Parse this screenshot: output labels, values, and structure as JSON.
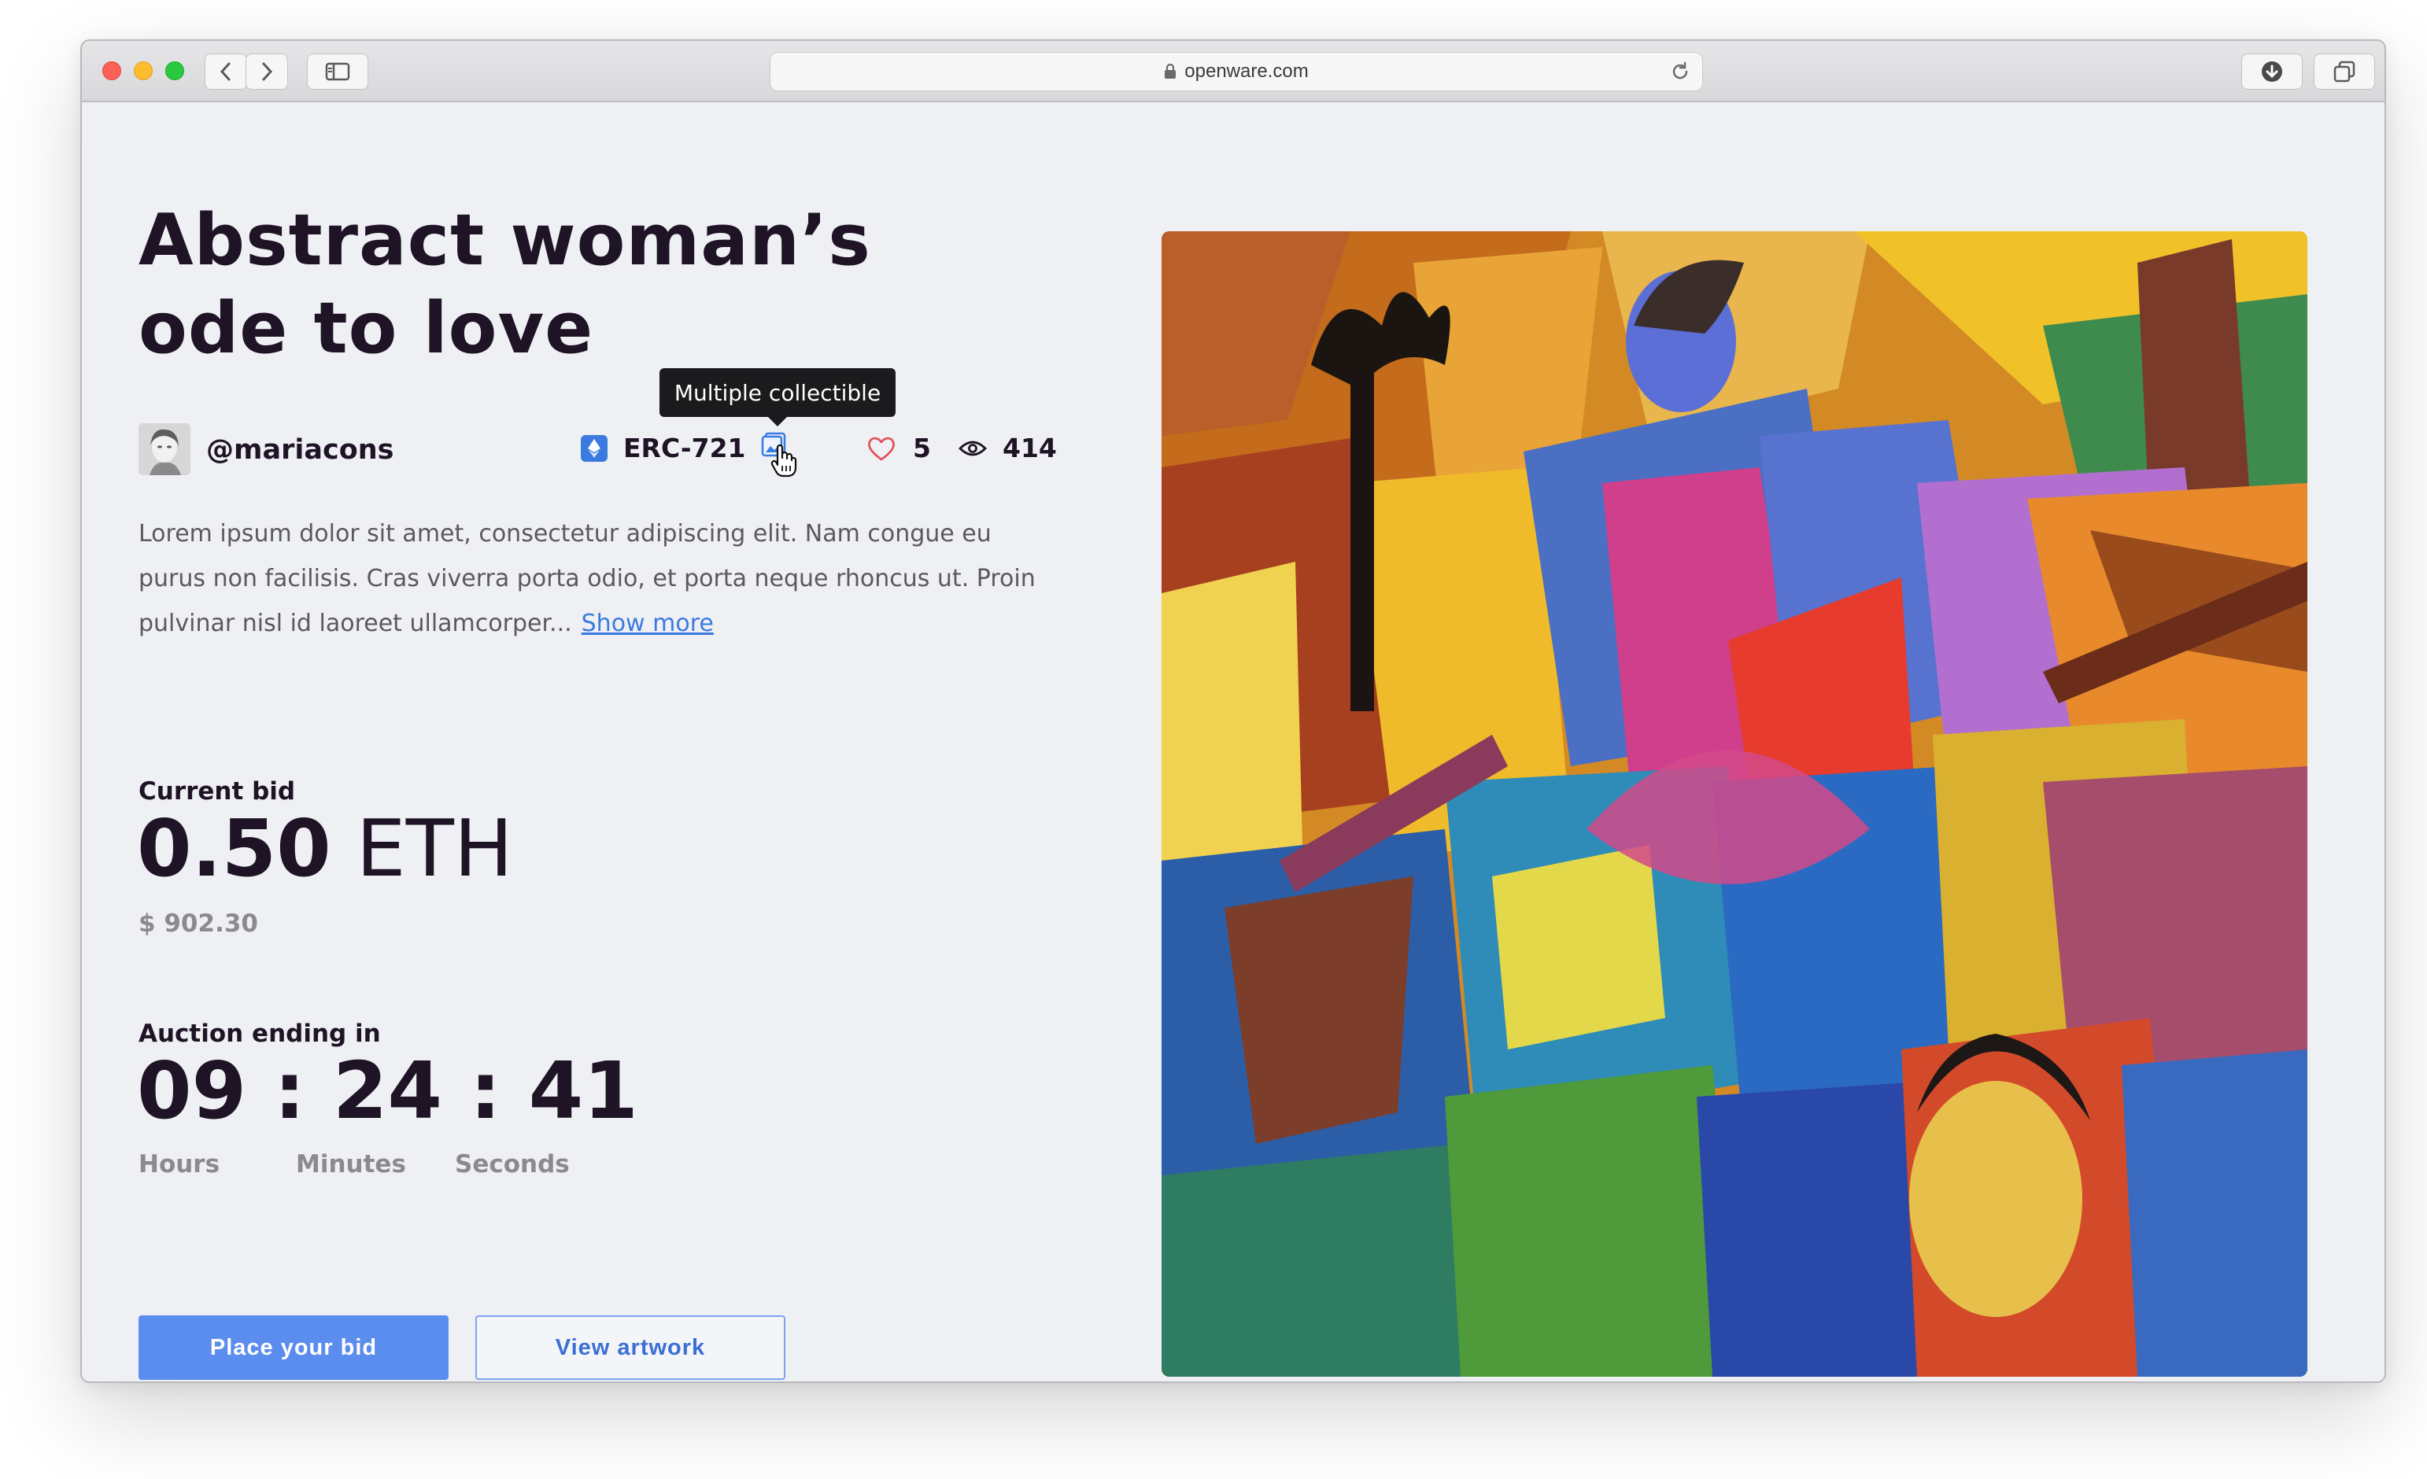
{
  "browser": {
    "url": "openware.com"
  },
  "nft": {
    "title_line1": "Abstract woman’s",
    "title_line2": "ode to love",
    "creator": "@mariacons",
    "standard": "ERC-721",
    "likes": "5",
    "views": "414",
    "tooltip": "Multiple collectible",
    "description": "Lorem ipsum dolor sit amet, consectetur adipiscing elit. Nam congue eu purus non facilisis. Cras viverra porta odio, et porta neque rhoncus ut. Proin pulvinar nisl id laoreet ullamcorper...",
    "show_more": "Show more"
  },
  "bid": {
    "label": "Current bid",
    "amount": "0.50",
    "currency": "ETH",
    "usd": "$ 902.30"
  },
  "auction": {
    "label": "Auction ending in",
    "hours": "09",
    "minutes": "24",
    "seconds": "41",
    "separator": ":",
    "hours_label": "Hours",
    "minutes_label": "Minutes",
    "seconds_label": "Seconds"
  },
  "actions": {
    "place_bid": "Place your bid",
    "view_artwork": "View artwork"
  },
  "colors": {
    "accent": "#5b8def",
    "link": "#3b7be0",
    "text": "#1e1425",
    "muted": "#8a8a90",
    "heart": "#e0525a"
  },
  "icons": [
    "back-icon",
    "forward-icon",
    "sidebar-icon",
    "lock-icon",
    "reload-icon",
    "download-icon",
    "tabs-icon",
    "ethereum-icon",
    "multiple-collectible-icon",
    "hand-cursor-icon",
    "heart-icon",
    "eye-icon"
  ]
}
